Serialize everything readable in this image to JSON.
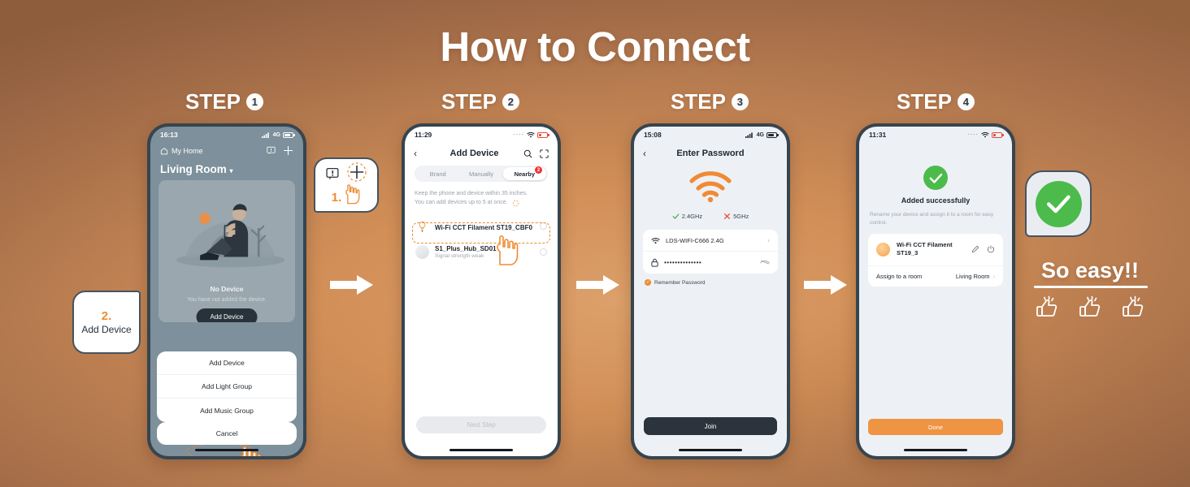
{
  "title": "How to Connect",
  "steps": [
    {
      "label": "STEP",
      "number": "1"
    },
    {
      "label": "STEP",
      "number": "2"
    },
    {
      "label": "STEP",
      "number": "3"
    },
    {
      "label": "STEP",
      "number": "4"
    }
  ],
  "colors": {
    "accent_orange": "#EE8C33",
    "frame_dark": "#36454F",
    "success_green": "#4CBB4C",
    "badge_red": "#F0342C",
    "bg_brown": "#A46F4B",
    "bg_light": "#D18E56"
  },
  "callouts": {
    "one": {
      "number": "1."
    },
    "two": {
      "number": "2.",
      "text": "Add Device"
    }
  },
  "outro": {
    "tagline": "So easy!!"
  },
  "phone1": {
    "time": "16:13",
    "network": "4G",
    "home_label": "My Home",
    "room": "Living Room",
    "empty_title": "No Device",
    "empty_sub": "You have not added the device.",
    "add_device_button": "Add Device",
    "sheet": {
      "items": [
        "Add Device",
        "Add Light Group",
        "Add Music Group"
      ],
      "cancel": "Cancel"
    }
  },
  "phone2": {
    "time": "11:29",
    "title": "Add Device",
    "tabs": [
      {
        "label": "Brand",
        "active": false,
        "badge": ""
      },
      {
        "label": "Manually",
        "active": false,
        "badge": ""
      },
      {
        "label": "Nearby",
        "active": true,
        "badge": "2"
      }
    ],
    "hint_line1": "Keep the phone and device within 35 inches.",
    "hint_line2": "You can add devices up to 5 at once.",
    "devices": [
      {
        "name": "Wi-Fi CCT Filament ST19_CBF0",
        "sub": "",
        "highlighted": true
      },
      {
        "name": "S1_Plus_Hub_SD01",
        "sub": "Signal strength weak",
        "highlighted": false
      }
    ],
    "next_button": "Next Step"
  },
  "phone3": {
    "time": "15:08",
    "network": "4G",
    "title": "Enter Password",
    "band_ok": "2.4GHz",
    "band_bad": "5GHz",
    "ssid": "LDS-WIFI-C666 2.4G",
    "password_masked": "••••••••••••••",
    "remember_label": "Remember Password",
    "join_button": "Join"
  },
  "phone4": {
    "time": "11:31",
    "success_title": "Added successfully",
    "success_sub": "Rename your device and assign it to a room for easy control.",
    "device_name_line1": "Wi-Fi CCT Filament",
    "device_name_line2": "ST19_3",
    "assign_label": "Assign to a room",
    "assign_value": "Living Room",
    "done_button": "Done"
  }
}
